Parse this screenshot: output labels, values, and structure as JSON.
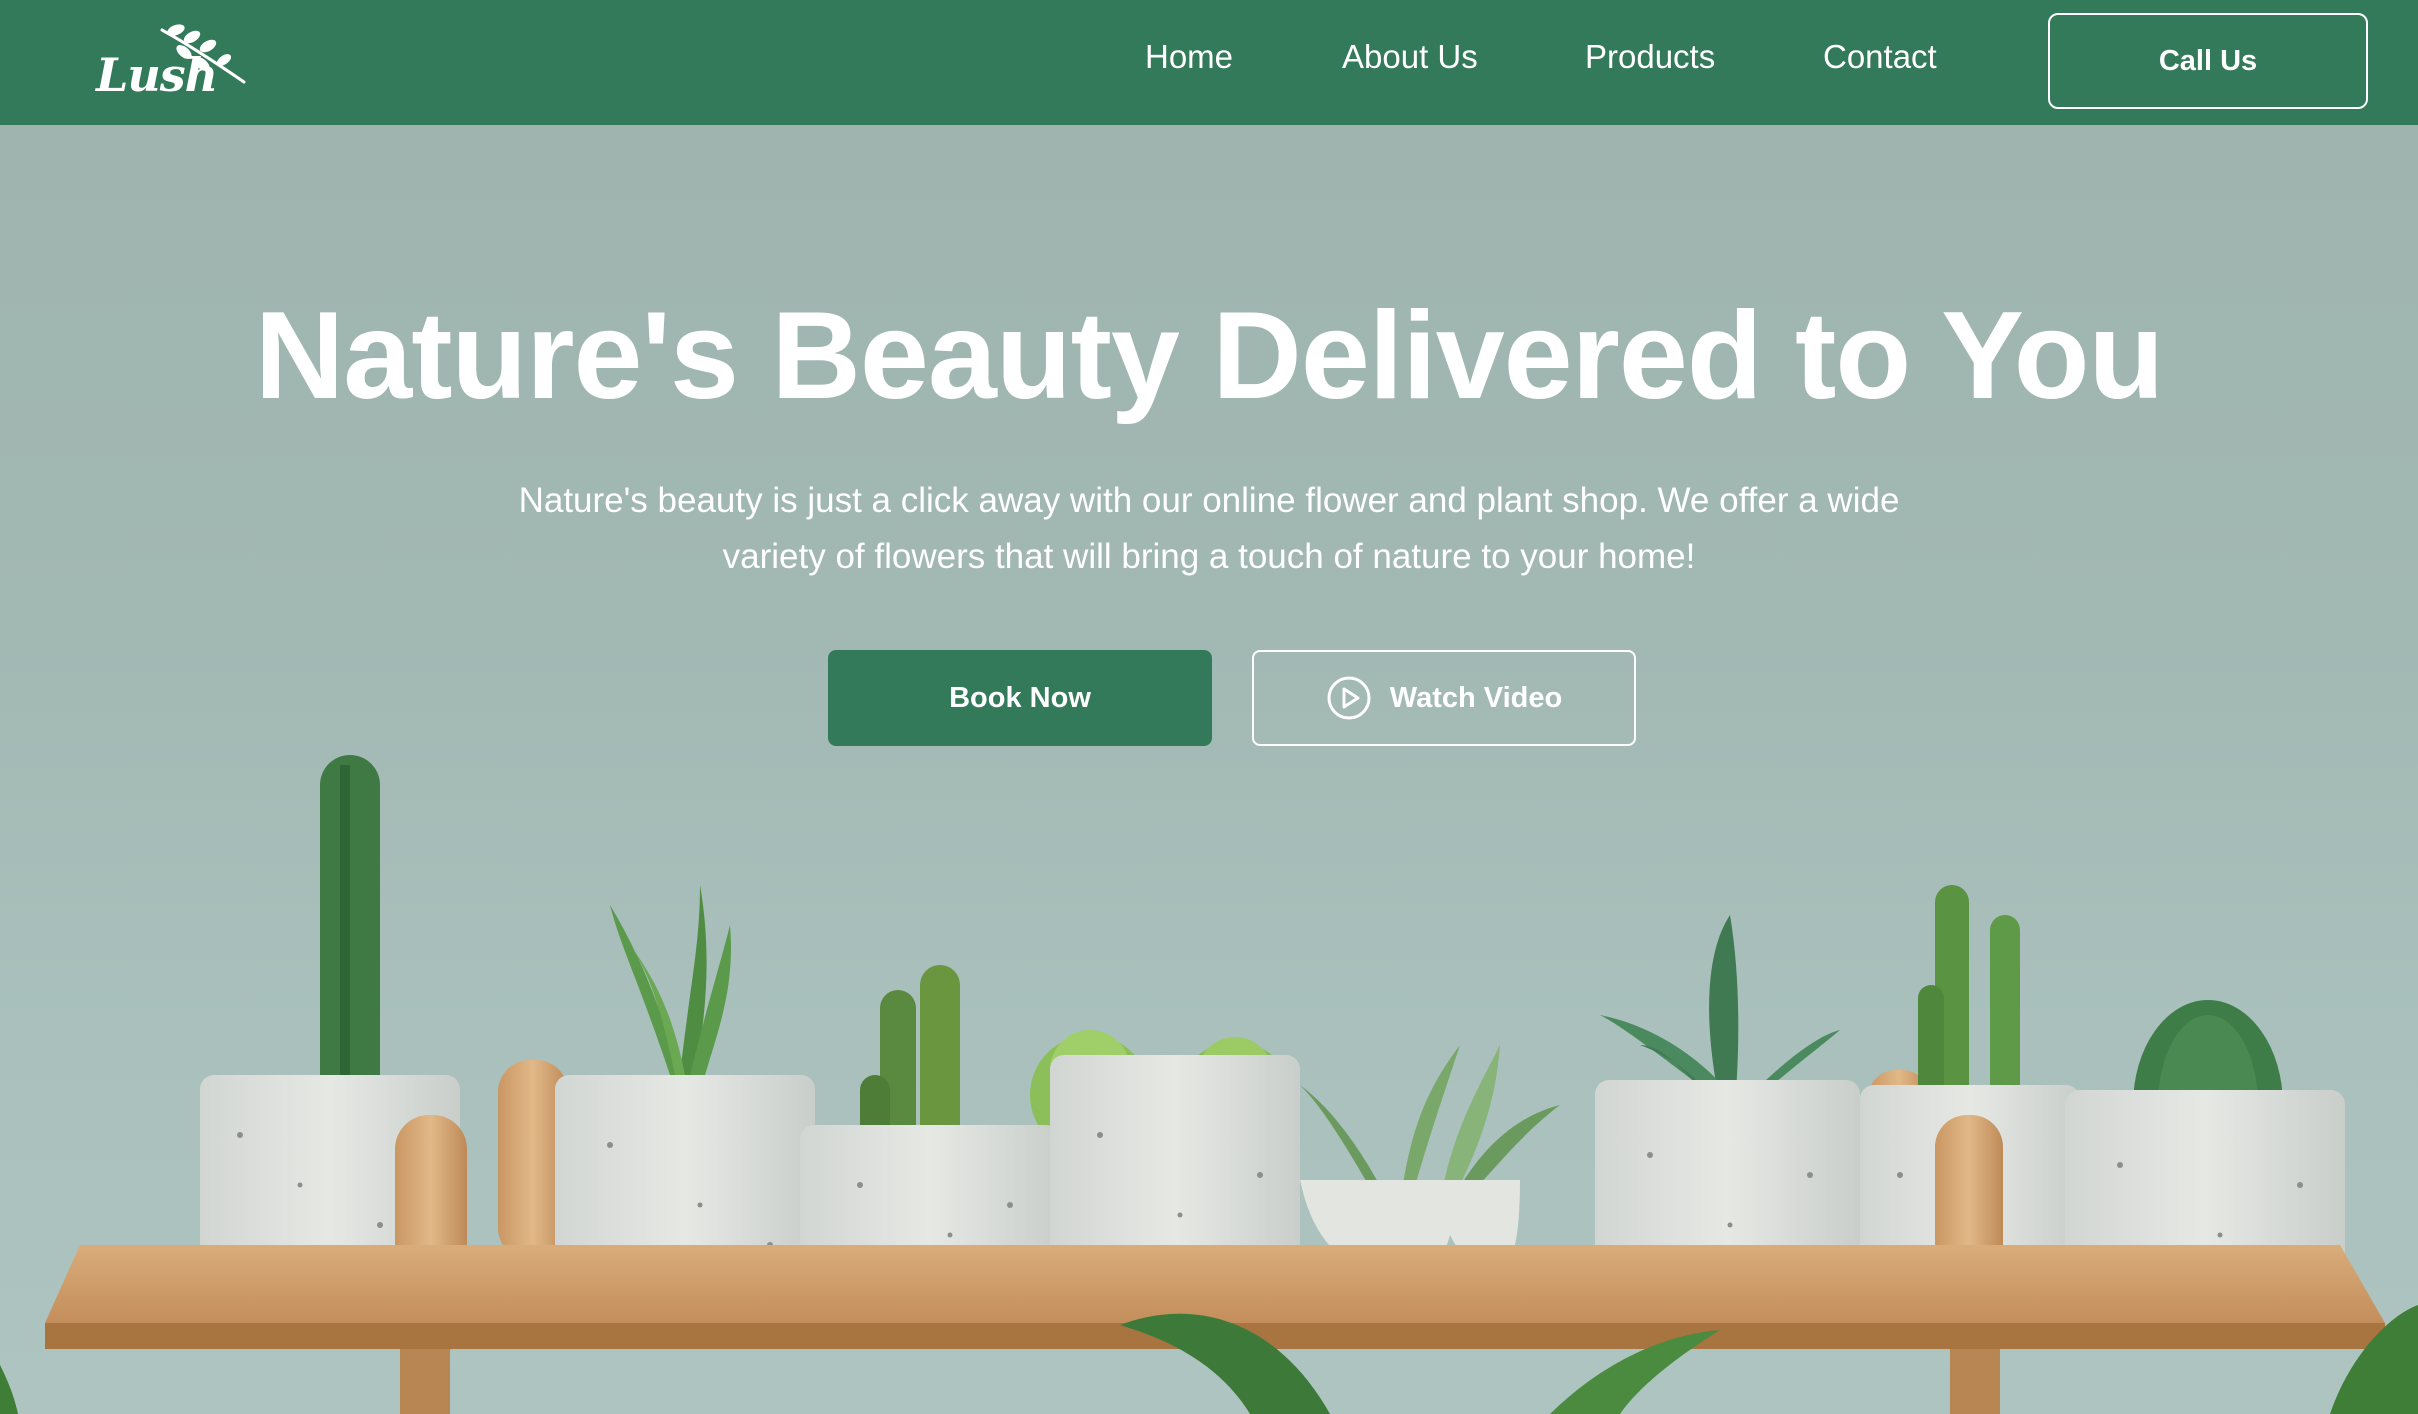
{
  "brand": {
    "logo_text": "Lush"
  },
  "nav": {
    "items": [
      {
        "label": "Home"
      },
      {
        "label": "About Us"
      },
      {
        "label": "Products"
      },
      {
        "label": "Contact"
      }
    ],
    "cta_label": "Call Us"
  },
  "hero": {
    "title": "Nature's Beauty Delivered to You",
    "subtitle": "Nature's beauty is just a click away with our online flower and plant shop. We offer a wide variety of flowers that will bring a touch of nature to your home!",
    "primary_button": "Book Now",
    "secondary_button": "Watch Video",
    "secondary_icon": "play-circle-icon",
    "background_image": "potted-succulents-on-wooden-shelf"
  },
  "colors": {
    "brand_green": "#327a5a",
    "text_on_brand": "#ffffff",
    "hero_background": "#9fb4ae"
  }
}
